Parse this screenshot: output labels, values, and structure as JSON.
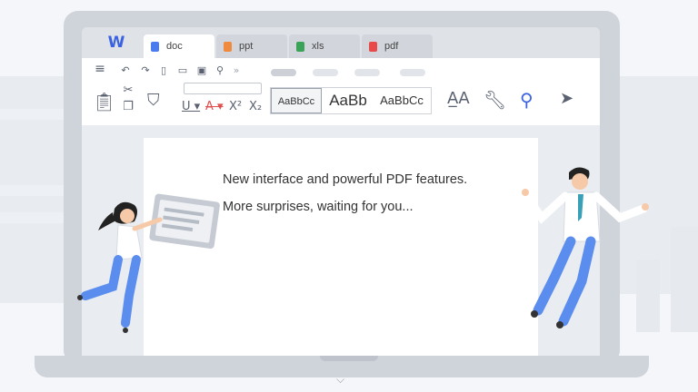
{
  "tabs": [
    {
      "label": "doc",
      "icon": "doc-file-icon",
      "color": "#4a7cf0",
      "active": true
    },
    {
      "label": "ppt",
      "icon": "ppt-file-icon",
      "color": "#f08a3c",
      "active": false
    },
    {
      "label": "xls",
      "icon": "xls-file-icon",
      "color": "#3aa357",
      "active": false
    },
    {
      "label": "pdf",
      "icon": "pdf-file-icon",
      "color": "#e84a4a",
      "active": false
    }
  ],
  "toolbar": {
    "style_samples": [
      "AaBbCc",
      "AaBb",
      "AaBbCc"
    ],
    "icons": [
      "menu-icon",
      "undo-icon",
      "redo-icon",
      "new-file-icon",
      "open-folder-icon",
      "save-icon",
      "find-icon",
      "more-icon",
      "paste-icon",
      "cut-icon",
      "copy-icon",
      "format-painter-icon",
      "underline-icon",
      "strikethrough-icon",
      "superscript-icon",
      "subscript-icon",
      "text-style-icon",
      "tools-icon",
      "search-icon",
      "select-cursor-icon"
    ]
  },
  "document": {
    "line1": "New interface and powerful PDF features.",
    "line2": "More surprises, waiting for you..."
  },
  "colors": {
    "accent": "#3b62e0",
    "person_pants": "#5b8def",
    "tie": "#3aa0b8"
  }
}
